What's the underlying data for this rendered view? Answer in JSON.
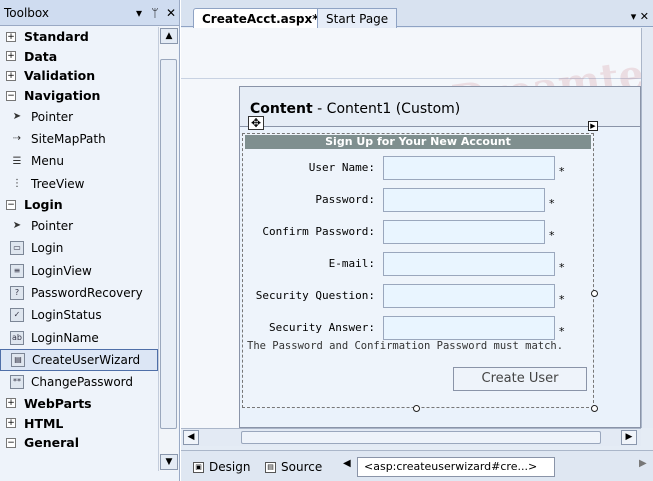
{
  "toolbox": {
    "title": "Toolbox",
    "controls": {
      "dropdown": "▾",
      "pin": "ᛘ",
      "close": "✕"
    },
    "categories": [
      {
        "name": "Standard",
        "expanded": false
      },
      {
        "name": "Data",
        "expanded": false
      },
      {
        "name": "Validation",
        "expanded": false
      },
      {
        "name": "Navigation",
        "expanded": true,
        "items": [
          {
            "label": "Pointer",
            "icon": "pointer-icon"
          },
          {
            "label": "SiteMapPath",
            "icon": "sitemappath-icon"
          },
          {
            "label": "Menu",
            "icon": "menu-icon"
          },
          {
            "label": "TreeView",
            "icon": "treeview-icon"
          }
        ]
      },
      {
        "name": "Login",
        "expanded": true,
        "items": [
          {
            "label": "Pointer",
            "icon": "pointer-icon"
          },
          {
            "label": "Login",
            "icon": "login-icon"
          },
          {
            "label": "LoginView",
            "icon": "loginview-icon"
          },
          {
            "label": "PasswordRecovery",
            "icon": "passwordrecovery-icon"
          },
          {
            "label": "LoginStatus",
            "icon": "loginstatus-icon"
          },
          {
            "label": "LoginName",
            "icon": "loginname-icon"
          },
          {
            "label": "CreateUserWizard",
            "icon": "createuserwizard-icon",
            "selected": true
          },
          {
            "label": "ChangePassword",
            "icon": "changepassword-icon"
          }
        ]
      },
      {
        "name": "WebParts",
        "expanded": false
      },
      {
        "name": "HTML",
        "expanded": false
      },
      {
        "name": "General",
        "expanded": true
      }
    ]
  },
  "editor": {
    "tabs": [
      {
        "label": "CreateAcct.aspx*",
        "active": true
      },
      {
        "label": "Start Page",
        "active": false
      }
    ],
    "tab_controls": {
      "dropdown": "▾",
      "close": "✕"
    },
    "content": {
      "title_bold": "Content",
      "title_rest": " - Content1 (Custom)"
    },
    "wizard": {
      "header": "Sign Up for Your New Account",
      "fields": [
        {
          "label": "User Name:",
          "required": "*"
        },
        {
          "label": "Password:",
          "required": "*"
        },
        {
          "label": "Confirm Password:",
          "required": "*"
        },
        {
          "label": "E-mail:",
          "required": "*"
        },
        {
          "label": "Security Question:",
          "required": "*"
        },
        {
          "label": "Security Answer:",
          "required": "*"
        }
      ],
      "message": "The Password and Confirmation Password must match.",
      "button": "Create User"
    },
    "bottom": {
      "design_label": "Design",
      "source_label": "Source",
      "tag_path": "<asp:createuserwizard#cre...>"
    },
    "watermark": "Dreamtech"
  },
  "colors": {
    "toolbox_bg": "#eef3fa",
    "wizard_header": "#7f8f8f",
    "selection": "#dce6f5"
  }
}
